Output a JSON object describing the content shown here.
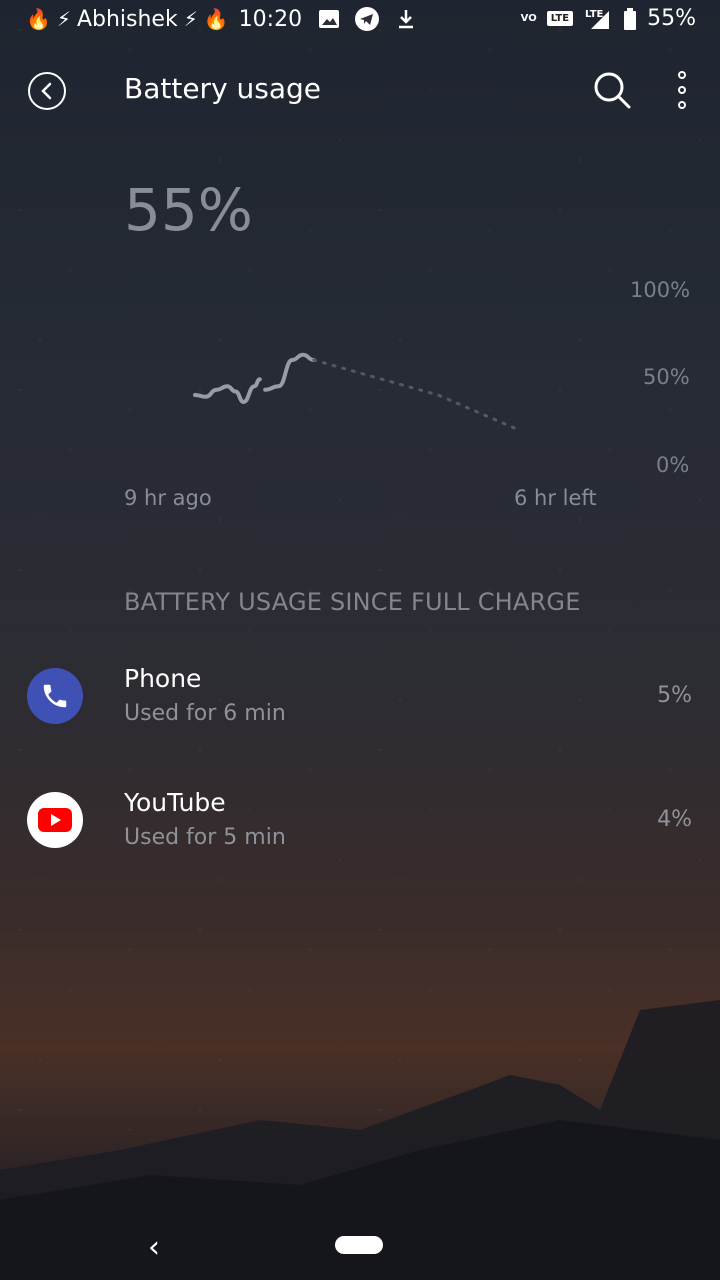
{
  "status_bar": {
    "left_emojis": [
      "🔥",
      "⚡"
    ],
    "carrier_name": "Abhishek",
    "right_emojis": [
      "⚡",
      "🔥"
    ],
    "time": "10:20",
    "vo_label": "VO",
    "lte_box_label": "LTE",
    "lte_label": "LTE",
    "battery_percent": "55%"
  },
  "app_bar": {
    "title": "Battery usage"
  },
  "battery": {
    "level_text": "55%",
    "level_percent": 55
  },
  "chart_data": {
    "type": "line",
    "y_tick_labels": [
      "100%",
      "50%",
      "0%"
    ],
    "ylim": [
      0,
      100
    ],
    "x_start_label": "9 hr ago",
    "x_end_label": "6 hr left",
    "series": [
      {
        "points_hours": [
          [
            0.0,
            40
          ],
          [
            0.4,
            39
          ],
          [
            0.8,
            43
          ],
          [
            1.2,
            45
          ],
          [
            1.5,
            42
          ],
          [
            1.8,
            36
          ],
          [
            2.2,
            45
          ],
          [
            2.4,
            49
          ]
        ]
      },
      {
        "points_hours": [
          [
            2.6,
            43
          ],
          [
            3.1,
            45
          ],
          [
            3.6,
            60
          ],
          [
            4.0,
            63
          ],
          [
            4.4,
            60
          ]
        ]
      }
    ],
    "projection_points_hours": [
      [
        4.4,
        60
      ],
      [
        9.0,
        40
      ],
      [
        12.0,
        20
      ]
    ]
  },
  "usage": {
    "header": "BATTERY USAGE SINCE FULL CHARGE",
    "apps": [
      {
        "name": "Phone",
        "detail": "Used for 6 min",
        "percent": "5%",
        "icon": "phone-icon",
        "color": "#3f51b5"
      },
      {
        "name": "YouTube",
        "detail": "Used for 5 min",
        "percent": "4%",
        "icon": "youtube-icon",
        "color": "#ff0000"
      }
    ]
  },
  "nav": {
    "back": "‹"
  }
}
